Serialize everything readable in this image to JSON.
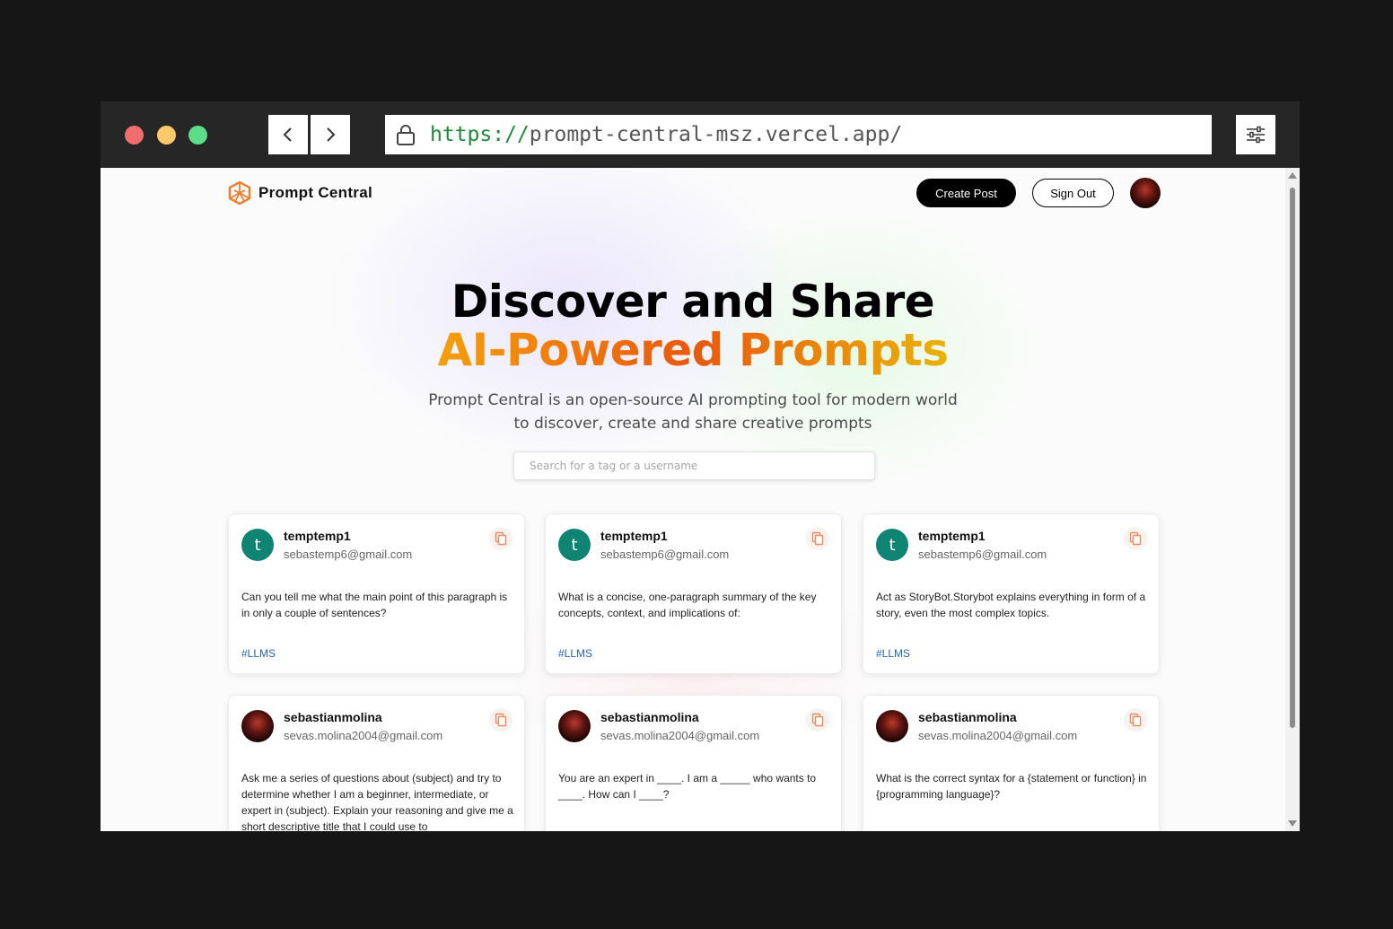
{
  "browser": {
    "url_scheme": "https://",
    "url_rest": "prompt-central-msz.vercel.app/"
  },
  "nav": {
    "brand": "Prompt Central",
    "create_label": "Create Post",
    "signout_label": "Sign Out"
  },
  "hero": {
    "title_line1": "Discover and Share",
    "title_line2": "AI-Powered Prompts",
    "description": "Prompt Central is an open-source AI prompting tool for modern world to discover, create and share creative prompts"
  },
  "search": {
    "placeholder": "Search for a tag or a username"
  },
  "cards": [
    {
      "avatar_letter": "t",
      "username": "temptemp1",
      "email": "sebastemp6@gmail.com",
      "prompt": "Can you tell me what the main point of this paragraph is in only a couple of sentences?",
      "tag": "#LLMS"
    },
    {
      "avatar_letter": "t",
      "username": "temptemp1",
      "email": "sebastemp6@gmail.com",
      "prompt": "What is a concise, one-paragraph summary of the key concepts, context, and implications of:",
      "tag": "#LLMS"
    },
    {
      "avatar_letter": "t",
      "username": "temptemp1",
      "email": "sebastemp6@gmail.com",
      "prompt": "Act as StoryBot.Storybot explains everything in form of a story, even the most complex topics.",
      "tag": "#LLMS"
    },
    {
      "avatar_letter": "",
      "username": "sebastianmolina",
      "email": "sevas.molina2004@gmail.com",
      "prompt": "Ask me a series of questions about (subject) and try to determine whether I am a beginner, intermediate, or expert in (subject). Explain your reasoning and give me a short descriptive title that I could use to",
      "tag": ""
    },
    {
      "avatar_letter": "",
      "username": "sebastianmolina",
      "email": "sevas.molina2004@gmail.com",
      "prompt": "You are an expert in ____. I am a _____ who wants to ____. How can I ____?",
      "tag": ""
    },
    {
      "avatar_letter": "",
      "username": "sebastianmolina",
      "email": "sevas.molina2004@gmail.com",
      "prompt": "What is the correct syntax for a {statement or function} in {programming language}?",
      "tag": ""
    }
  ],
  "colors": {
    "accent_orange": "#ea580c",
    "tag_blue": "#2563b8",
    "avatar_teal": "#0f8472"
  }
}
